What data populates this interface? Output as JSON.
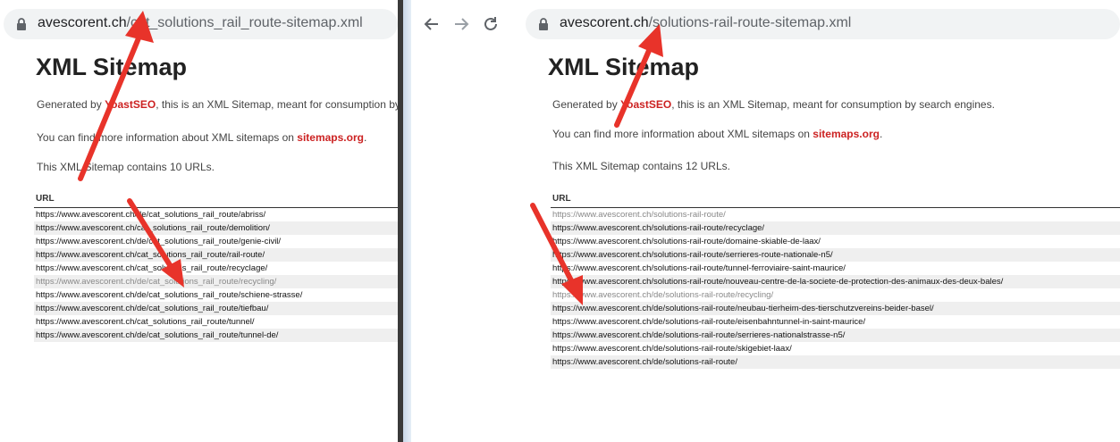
{
  "left": {
    "url_host": "avescorent.ch",
    "url_path": "/cat_solutions_rail_route-sitemap.xml",
    "title": "XML Sitemap",
    "generated_prefix": "Generated by ",
    "generated_link": "YoastSEO",
    "generated_suffix": ", this is an XML Sitemap, meant for consumption by search engines.",
    "info_prefix": "You can find more information about XML sitemaps on ",
    "info_link": "sitemaps.org",
    "info_suffix": ".",
    "count_text": "This XML Sitemap contains 10 URLs.",
    "column_header": "URL",
    "rows": [
      {
        "url": "https://www.avescorent.ch/de/cat_solutions_rail_route/abriss/",
        "gray": false
      },
      {
        "url": "https://www.avescorent.ch/cat_solutions_rail_route/demolition/",
        "gray": false
      },
      {
        "url": "https://www.avescorent.ch/de/cat_solutions_rail_route/genie-civil/",
        "gray": false
      },
      {
        "url": "https://www.avescorent.ch/cat_solutions_rail_route/rail-route/",
        "gray": false
      },
      {
        "url": "https://www.avescorent.ch/cat_solutions_rail_route/recyclage/",
        "gray": false
      },
      {
        "url": "https://www.avescorent.ch/de/cat_solutions_rail_route/recycling/",
        "gray": true
      },
      {
        "url": "https://www.avescorent.ch/de/cat_solutions_rail_route/schiene-strasse/",
        "gray": false
      },
      {
        "url": "https://www.avescorent.ch/de/cat_solutions_rail_route/tiefbau/",
        "gray": false
      },
      {
        "url": "https://www.avescorent.ch/cat_solutions_rail_route/tunnel/",
        "gray": false
      },
      {
        "url": "https://www.avescorent.ch/de/cat_solutions_rail_route/tunnel-de/",
        "gray": false
      }
    ]
  },
  "right": {
    "url_host": "avescorent.ch",
    "url_path": "/solutions-rail-route-sitemap.xml",
    "title": "XML Sitemap",
    "generated_prefix": "Generated by ",
    "generated_link": "YoastSEO",
    "generated_suffix": ", this is an XML Sitemap, meant for consumption by search engines.",
    "info_prefix": "You can find more information about XML sitemaps on ",
    "info_link": "sitemaps.org",
    "info_suffix": ".",
    "count_text": "This XML Sitemap contains 12 URLs.",
    "column_header": "URL",
    "rows": [
      {
        "url": "https://www.avescorent.ch/solutions-rail-route/",
        "gray": true
      },
      {
        "url": "https://www.avescorent.ch/solutions-rail-route/recyclage/",
        "gray": false
      },
      {
        "url": "https://www.avescorent.ch/solutions-rail-route/domaine-skiable-de-laax/",
        "gray": false
      },
      {
        "url": "https://www.avescorent.ch/solutions-rail-route/serrieres-route-nationale-n5/",
        "gray": false
      },
      {
        "url": "https://www.avescorent.ch/solutions-rail-route/tunnel-ferroviaire-saint-maurice/",
        "gray": false
      },
      {
        "url": "https://www.avescorent.ch/solutions-rail-route/nouveau-centre-de-la-societe-de-protection-des-animaux-des-deux-bales/",
        "gray": false
      },
      {
        "url": "https://www.avescorent.ch/de/solutions-rail-route/recycling/",
        "gray": true
      },
      {
        "url": "https://www.avescorent.ch/de/solutions-rail-route/neubau-tierheim-des-tierschutzvereins-beider-basel/",
        "gray": false
      },
      {
        "url": "https://www.avescorent.ch/de/solutions-rail-route/eisenbahntunnel-in-saint-maurice/",
        "gray": false
      },
      {
        "url": "https://www.avescorent.ch/de/solutions-rail-route/serrieres-nationalstrasse-n5/",
        "gray": false
      },
      {
        "url": "https://www.avescorent.ch/de/solutions-rail-route/skigebiet-laax/",
        "gray": false
      },
      {
        "url": "https://www.avescorent.ch/de/solutions-rail-route/",
        "gray": false
      }
    ]
  },
  "icons": {
    "back": "back-arrow-icon",
    "forward": "forward-arrow-icon",
    "reload": "reload-icon",
    "lock": "lock-icon"
  },
  "colors": {
    "annotation_arrow": "#e8332a",
    "link_red": "#cc2222",
    "omnibox_bg": "#f1f3f4"
  }
}
